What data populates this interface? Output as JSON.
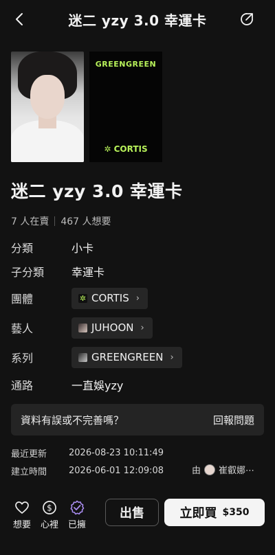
{
  "header": {
    "title": "迷二 yzy 3.0 幸運卡"
  },
  "card_back": {
    "top_text": "GREENGREEN",
    "brand": "CORTIS"
  },
  "product": {
    "title": "迷二 yzy 3.0 幸運卡"
  },
  "stats": {
    "selling": "7 人在賣",
    "wanting": "467 人想要"
  },
  "details": {
    "category": {
      "label": "分類",
      "value": "小卡"
    },
    "subcategory": {
      "label": "子分類",
      "value": "幸運卡"
    },
    "group": {
      "label": "團體",
      "value": "CORTIS"
    },
    "artist": {
      "label": "藝人",
      "value": "JUHOON"
    },
    "series": {
      "label": "系列",
      "value": "GREENGREEN"
    },
    "channel": {
      "label": "通路",
      "value": "一直娛yzy"
    }
  },
  "report": {
    "question": "資料有誤或不完善嗎？",
    "link": "回報問題"
  },
  "meta": {
    "updated_label": "最近更新",
    "updated_value": "2026-08-23 10:11:49",
    "created_label": "建立時間",
    "created_value": "2026-06-01 12:09:08",
    "creator_prefix": "由",
    "creator_name": "崔叡娜⋯"
  },
  "bottom": {
    "want": "想要",
    "heart_mind": "心裡",
    "owned": "已擁",
    "sell": "出售",
    "buy": "立即買",
    "price": "$350"
  },
  "colors": {
    "accent_green": "#b8f25a",
    "owned_purple": "#a98cf0"
  }
}
